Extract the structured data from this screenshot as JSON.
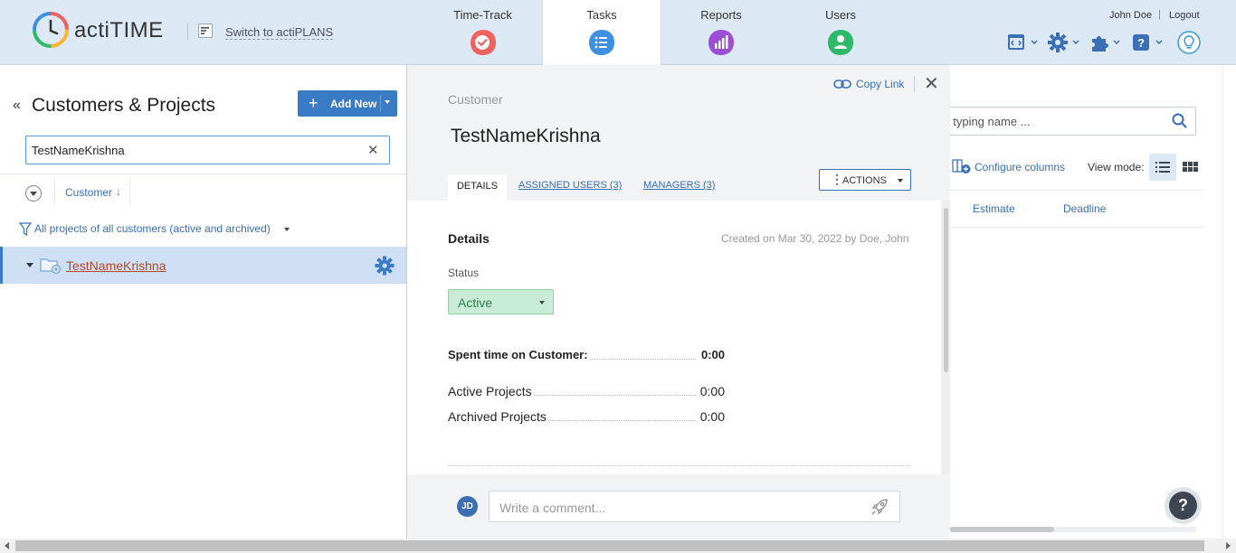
{
  "header": {
    "brand": "actiTIME",
    "switch_link": "Switch to actiPLANS",
    "nav": [
      {
        "label": "Time-Track",
        "icon": "check-icon",
        "color": "#f0625f"
      },
      {
        "label": "Tasks",
        "icon": "list-icon",
        "color": "#3f8fe0",
        "active": true
      },
      {
        "label": "Reports",
        "icon": "bar-chart-icon",
        "color": "#9b4fd6"
      },
      {
        "label": "Users",
        "icon": "user-icon",
        "color": "#2fb868"
      }
    ],
    "user_name": "John Doe",
    "separator": "|",
    "logout": "Logout",
    "tools": [
      "calendar-code-icon",
      "gear-icon",
      "puzzle-icon",
      "help-icon",
      "lightbulb-icon"
    ]
  },
  "left_panel": {
    "title": "Customers & Projects",
    "add_new": "Add New",
    "search_value": "TestNameKrishna",
    "column_customer": "Customer",
    "filter": "All projects of all customers (active and archived)",
    "tree": [
      {
        "name": "TestNameKrishna",
        "selected": true
      }
    ]
  },
  "detail": {
    "copy_link": "Copy Link",
    "kind": "Customer",
    "name": "TestNameKrishna",
    "tabs": {
      "details": "DETAILS",
      "assigned": "ASSIGNED USERS (3)",
      "managers": "MANAGERS (3)"
    },
    "actions": "ACTIONS",
    "section_title": "Details",
    "created": "Created on Mar 30, 2022 by Doe, John",
    "status_label": "Status",
    "status_value": "Active",
    "spent_label": "Spent time on Customer:",
    "spent_value": "0:00",
    "active_projects_label": "Active Projects",
    "active_projects_value": "0:00",
    "archived_projects_label": "Archived Projects",
    "archived_projects_value": "0:00",
    "avatar_initials": "JD",
    "comment_placeholder": "Write a comment..."
  },
  "right_panel": {
    "search_placeholder": "t typing name ...",
    "configure_columns": "Configure columns",
    "view_mode": "View mode:",
    "col_estimate": "Estimate",
    "col_deadline": "Deadline"
  },
  "help_fab": "?",
  "colors": {
    "accent": "#3a7bc5",
    "topbar": "#dde8f5",
    "status_active": "#c8ecd5",
    "link": "#3a6fb5",
    "tree_link": "#b2492a"
  }
}
